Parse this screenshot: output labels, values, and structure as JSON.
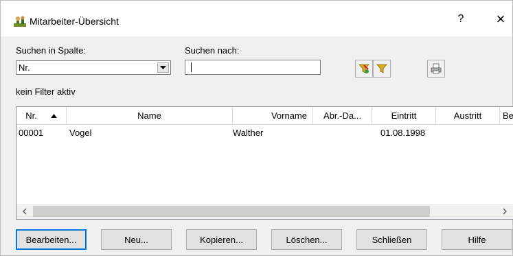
{
  "window": {
    "title": "Mitarbeiter-Übersicht",
    "help_label": "?",
    "close_label": "×"
  },
  "search": {
    "column_label": "Suchen in Spalte:",
    "column_value": "Nr.",
    "term_label": "Suchen nach:",
    "term_value": ""
  },
  "toolbar": {
    "icons": [
      "filter-set-icon",
      "filter-remove-icon",
      "print-icon"
    ]
  },
  "filter_status": "kein Filter aktiv",
  "table": {
    "columns": [
      "Nr.",
      "Name",
      "Vorname",
      "Abr.-Da...",
      "Eintritt",
      "Austritt",
      "Be"
    ],
    "sort_column": "Nr.",
    "sort_direction": "ascending",
    "rows": [
      {
        "nr": "00001",
        "name": "Vogel",
        "vorname": "Walther",
        "abr_datum": "",
        "eintritt": "01.08.1998",
        "austritt": "",
        "be": ""
      }
    ]
  },
  "buttons": {
    "edit": "Bearbeiten...",
    "new": "Neu...",
    "copy": "Kopieren...",
    "delete": "Löschen...",
    "close": "Schließen",
    "help": "Hilfe"
  },
  "colors": {
    "accent": "#0078d7",
    "window_bg": "#f0f0f0"
  }
}
